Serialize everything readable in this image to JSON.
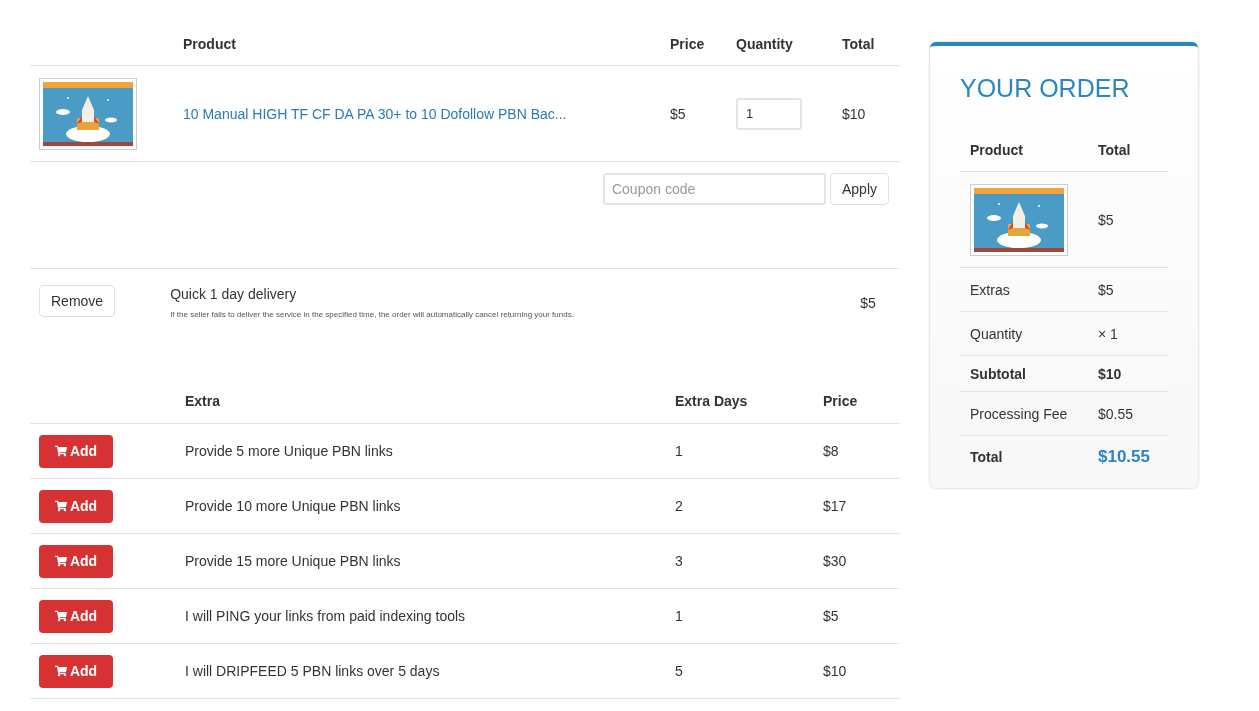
{
  "cart": {
    "columns": [
      "Product",
      "Price",
      "Quantity",
      "Total"
    ],
    "items": [
      {
        "title": "10 Manual HIGH TF CF DA PA 30+ to 10 Dofollow PBN Bac...",
        "price": "$5",
        "quantity": "1",
        "total": "$10"
      }
    ],
    "coupon": {
      "placeholder": "Coupon code",
      "button": "Apply"
    },
    "selected_extras": [
      {
        "button": "Remove",
        "title": "Quick 1 day delivery",
        "note": "If the seller fails to deliver the service in the specified time, the order will automatically cancel returning your funds.",
        "price": "$5"
      }
    ]
  },
  "extras": {
    "columns": [
      "Extra",
      "Extra Days",
      "Price"
    ],
    "rows": [
      {
        "button": "Add",
        "name": "Provide 5 more Unique PBN links",
        "days": "1",
        "price": "$8"
      },
      {
        "button": "Add",
        "name": "Provide 10 more Unique PBN links",
        "days": "2",
        "price": "$17"
      },
      {
        "button": "Add",
        "name": "Provide 15 more Unique PBN links",
        "days": "3",
        "price": "$30"
      },
      {
        "button": "Add",
        "name": "I will PING your links from paid indexing tools",
        "days": "1",
        "price": "$5"
      },
      {
        "button": "Add",
        "name": "I will DRIPFEED 5 PBN links over 5 days",
        "days": "5",
        "price": "$10"
      }
    ]
  },
  "order": {
    "title": "YOUR ORDER",
    "columns": [
      "Product",
      "Total"
    ],
    "product": {
      "total": "$5"
    },
    "lines": [
      {
        "kind": "normal",
        "label": "Extras",
        "value": "$5"
      },
      {
        "kind": "normal",
        "label": "Quantity",
        "value": "× 1"
      },
      {
        "kind": "subtotal",
        "label": "Subtotal",
        "value": "$10"
      },
      {
        "kind": "normal",
        "label": "Processing Fee",
        "value": "$0.55"
      },
      {
        "kind": "total",
        "label": "Total",
        "value": "$10.55"
      }
    ]
  }
}
